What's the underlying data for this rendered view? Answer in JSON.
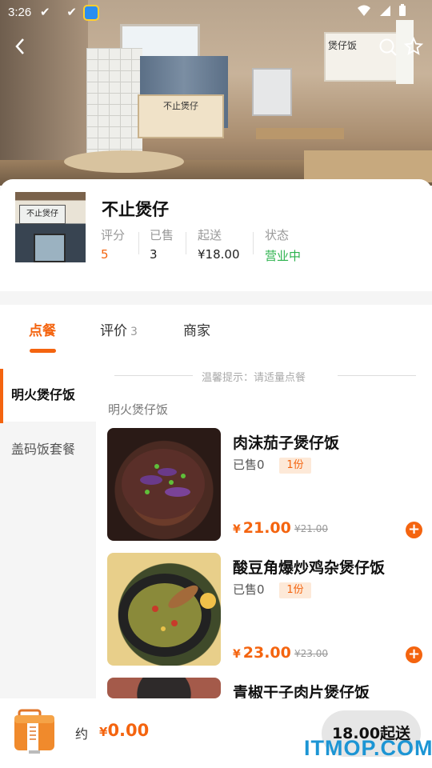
{
  "status_bar": {
    "time": "3:26",
    "left_icons": "✔ ✔"
  },
  "hero": {
    "counter_sign": "不止煲仔",
    "poster_title": "煲仔饭"
  },
  "shop": {
    "name": "不止煲仔",
    "photo_sign": "不止煲仔",
    "stats": [
      {
        "label": "评分",
        "value": "5",
        "color": "#f4640f"
      },
      {
        "label": "已售",
        "value": "3",
        "color": "#222222"
      },
      {
        "label": "起送",
        "value": "¥18.00",
        "color": "#222222"
      },
      {
        "label": "状态",
        "value": "营业中",
        "color": "#2bb24c"
      }
    ]
  },
  "tabs": {
    "order": "点餐",
    "reviews": "评价",
    "reviews_count": "3",
    "merchant": "商家"
  },
  "sidebar": {
    "items": [
      {
        "label": "明火煲仔饭"
      },
      {
        "label": "盖码饭套餐"
      }
    ]
  },
  "menu": {
    "tip": "温馨提示：请适量点餐",
    "section_title": "明火煲仔饭",
    "dishes": [
      {
        "name": "肉沫茄子煲仔饭",
        "sold": "已售0",
        "tag": "1份",
        "currency": "¥",
        "price": "21.00",
        "original": "¥21.00"
      },
      {
        "name": "酸豆角爆炒鸡杂煲仔饭",
        "sold": "已售0",
        "tag": "1份",
        "currency": "¥",
        "price": "23.00",
        "original": "¥23.00"
      },
      {
        "name": "青椒干子肉片煲仔饭"
      }
    ]
  },
  "cart": {
    "approx_label": "约",
    "currency": "¥",
    "total": "0.00",
    "checkout_label": "18.00起送"
  },
  "watermark": "ITMOP.COM",
  "colors": {
    "accent": "#f4640f",
    "open_status": "#2bb24c",
    "watermark": "#1c95d4"
  },
  "icons": [
    "back-arrow-icon",
    "search-icon",
    "star-icon",
    "add-icon",
    "shopping-bag-icon",
    "signal-icon",
    "wifi-icon",
    "battery-icon"
  ]
}
